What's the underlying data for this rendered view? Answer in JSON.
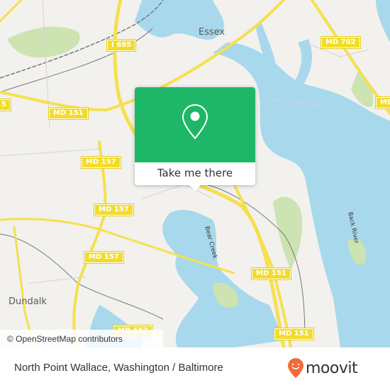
{
  "map": {
    "places": [
      {
        "name": "Essex"
      },
      {
        "name": "Dundalk"
      }
    ],
    "water_labels": [
      {
        "name": "Back River"
      },
      {
        "name": "Bear Creek"
      }
    ],
    "road_shields": [
      {
        "label": "I 695"
      },
      {
        "label": "MD 702"
      },
      {
        "label": "MD 151"
      },
      {
        "label": "MD 157"
      },
      {
        "label": "MD 157"
      },
      {
        "label": "MD 157"
      },
      {
        "label": "MD 157"
      },
      {
        "label": "MD 151"
      },
      {
        "label": "MD 151"
      },
      {
        "label": "MD 157"
      },
      {
        "label": "MD 151"
      },
      {
        "label": "MD"
      },
      {
        "label": "5"
      }
    ],
    "colors": {
      "land": "#f2f1ee",
      "water": "#a8d8ec",
      "park": "#cde3b1",
      "road": "#f5e04e",
      "rail": "#777777"
    }
  },
  "attribution": "© OpenStreetMap contributors",
  "popup": {
    "icon": "map-pin-icon",
    "action_label": "Take me there",
    "accent": "#1eb767"
  },
  "footer": {
    "location_title": "North Point Wallace, Washington / Baltimore",
    "brand": "moovit",
    "brand_color": "#f26b3a"
  }
}
